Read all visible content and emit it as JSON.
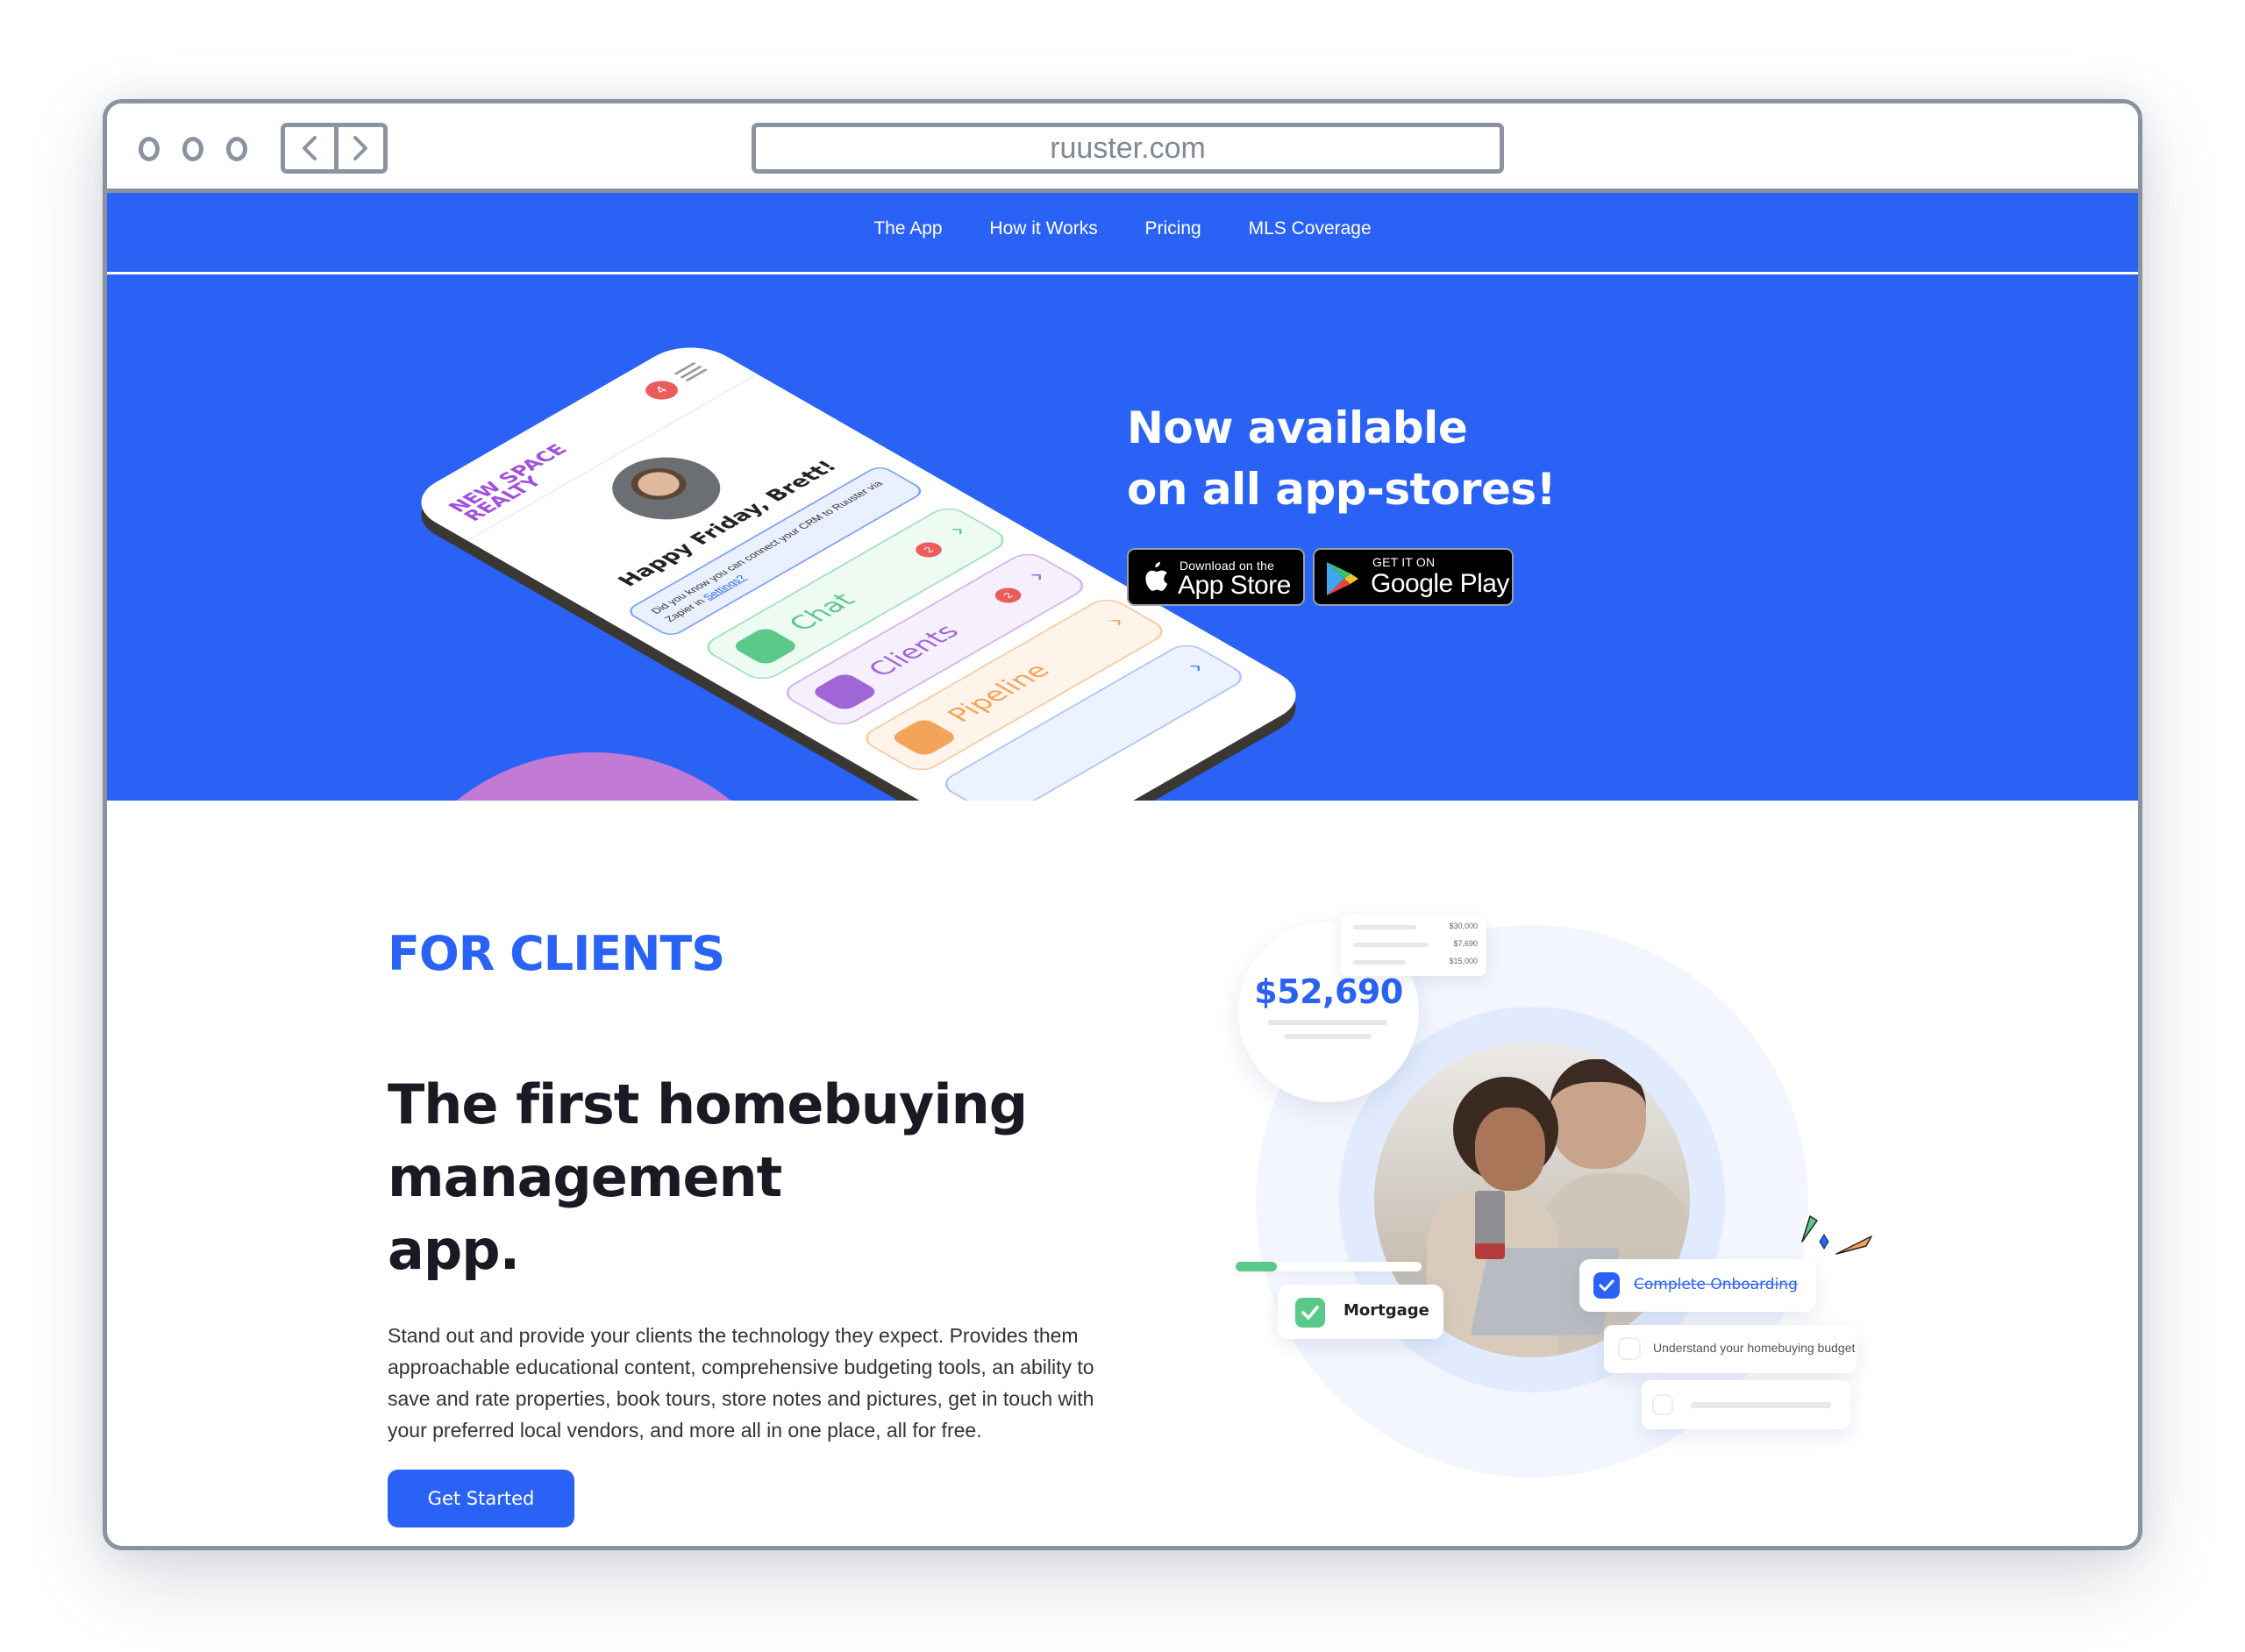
{
  "browser": {
    "url": "ruuster.com",
    "back_icon": "chevron-left-icon",
    "forward_icon": "chevron-right-icon"
  },
  "nav": {
    "items": [
      {
        "label": "The App"
      },
      {
        "label": "How it Works"
      },
      {
        "label": "Pricing"
      },
      {
        "label": "MLS Coverage"
      }
    ]
  },
  "hero": {
    "headline_line1": "Now available",
    "headline_line2": "on all app-stores!",
    "app_store": {
      "small": "Download on the",
      "big": "App Store"
    },
    "google_play": {
      "small": "GET IT ON",
      "big": "Google Play"
    },
    "phone": {
      "brand_line1": "NEW SPACE",
      "brand_line2": "REALTY",
      "notification_count": "4",
      "greeting": "Happy Friday, Brett!",
      "tip_text": "Did you know you can connect your CRM to Ruuster via Zapier in",
      "tip_link": "Settings?",
      "cards": [
        {
          "label": "Chat",
          "count": "2",
          "color": "#5bc98a"
        },
        {
          "label": "Clients",
          "count": "2",
          "color": "#a066d8"
        },
        {
          "label": "Pipeline",
          "count": "",
          "color": "#f3a35a"
        },
        {
          "label": "",
          "count": "",
          "color": "#4a86f5"
        }
      ]
    }
  },
  "section": {
    "eyebrow": "FOR CLIENTS",
    "title_line1": "The first homebuying",
    "title_line2": "management",
    "title_line3": "app.",
    "body": "Stand out and provide your clients the technology they expect. Provides them approachable educational content, comprehensive budgeting tools, an ability to save and rate properties, book tours, store notes and pictures, get in touch with your preferred local vendors, and more all in one place, all for free.",
    "cta": "Get Started"
  },
  "illustration": {
    "budget_total": "$52,690",
    "budget_rows": [
      "$30,000",
      "$7,690",
      "$15,000"
    ],
    "progress_fraction": 0.22,
    "mortgage_label": "Mortgage",
    "tasks": [
      {
        "label": "Complete Onboarding",
        "done": true
      },
      {
        "label": "Understand your homebuying budget",
        "done": false
      },
      {
        "label": "",
        "done": false
      }
    ]
  },
  "colors": {
    "brand_blue": "#2962f5",
    "frame_gray": "#8a939f",
    "success_green": "#5bc98a",
    "alert_red": "#ec5c5c",
    "heading_dark": "#1a1a24"
  }
}
